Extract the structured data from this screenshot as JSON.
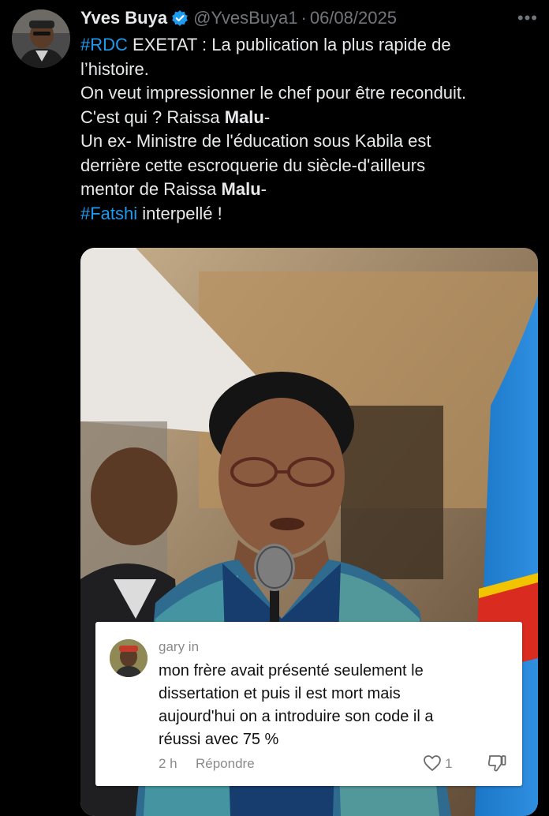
{
  "tweet": {
    "display_name": "Yves Buya",
    "handle": "@YvesBuya1",
    "separator": "·",
    "date": "06/08/2025",
    "more_label": "•••",
    "verified_color": "#1d9bf0",
    "text": {
      "l1_hashtag": "#RDC",
      "l1_rest": " EXETAT : La publication la plus rapide de",
      "l2": "l’histoire.",
      "l3": "On veut impressionner le chef pour être reconduit.",
      "l4_pre": "C'est qui ? Raissa ",
      "l4_bold": "Malu",
      "l4_post": "-",
      "l5": "Un ex- Ministre de l'éducation sous Kabila est",
      "l6": "derrière cette escroquerie du siècle-d'ailleurs",
      "l7_pre": "mentor de Raissa ",
      "l7_bold": "Malu",
      "l7_post": "-",
      "l8_hashtag": "#Fatshi",
      "l8_rest": " interpellé !"
    }
  },
  "comment": {
    "username": "gary in",
    "lines": [
      "mon frère avait présenté seulement le",
      "dissertation et puis il est mort mais",
      "aujourd'hui on a introduire son code il a",
      "réussi avec 75 %"
    ],
    "time": "2 h",
    "reply_label": "Répondre",
    "likes": "1"
  },
  "icons": {
    "verified": "verified-badge-icon",
    "more": "more-options-icon",
    "like": "heart-icon",
    "dislike": "thumbs-down-icon"
  },
  "colors": {
    "background": "#000000",
    "text": "#e7e9ea",
    "muted": "#71767b",
    "hashtag": "#1d9bf0"
  }
}
